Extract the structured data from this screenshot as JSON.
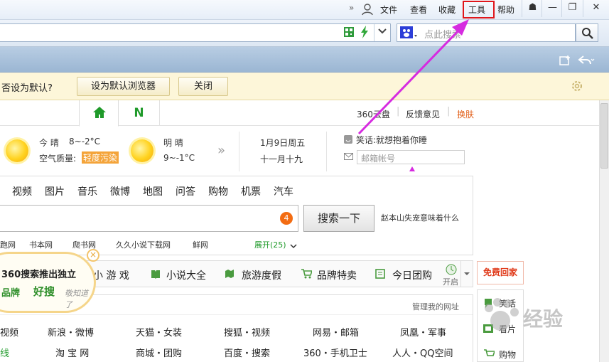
{
  "titlebar": {
    "menus": [
      "文件",
      "查看",
      "收藏",
      "工具",
      "帮助"
    ],
    "more": "»",
    "win_buttons": [
      "☗",
      "—",
      "❐",
      "✕"
    ]
  },
  "addressbar": {
    "search_placeholder": "点此搜索"
  },
  "notify": {
    "text": "否设为默认?",
    "set_default": "设为默认浏览器",
    "close": "关闭"
  },
  "page": {
    "tabs": {
      "home": "⌂",
      "n": "N"
    },
    "toplinks": [
      "360云盘",
      "反馈意见",
      "换肤"
    ],
    "weather": {
      "today_label": "今 晴",
      "today_temp": "8~-2°C",
      "aqi_label": "空气质量:",
      "aqi_value": "轻度污染",
      "tomorrow_label": "明 晴",
      "tomorrow_temp": "9~-1°C",
      "more": "»",
      "date": "1月9日周五",
      "lunar": "十一月十九"
    },
    "joke": "笑话:就想抱着你睡",
    "mail_placeholder": "邮箱帐号",
    "nav": [
      "视频",
      "图片",
      "音乐",
      "微博",
      "地图",
      "问答",
      "购物",
      "机票",
      "汽车"
    ],
    "search": {
      "badge": "4",
      "button": "搜索一下",
      "hot": "赵本山失宠意味着什么"
    },
    "links": [
      "跑网",
      "书本网",
      "爬书网",
      "久久小说下载网",
      "鲜网"
    ],
    "expand": "展开(25)",
    "promo": {
      "line1": "360搜索推出独立",
      "line2": "品牌",
      "brand": "好搜",
      "hand": "敬知道了"
    },
    "categories": [
      "小 游 戏",
      "小说大全",
      "旅游度假",
      "品牌特卖",
      "今日团购"
    ],
    "open_label": "开启",
    "free_home": "免费回家",
    "manage": "管理我的网址",
    "sites_row1": [
      "视频",
      "新浪・微博",
      "天猫・女装",
      "搜狐・视频",
      "网易・邮箱",
      "凤凰・军事"
    ],
    "sites_row2": [
      "线",
      "淘 宝 网",
      "商城・团购",
      "百度・搜索",
      "360・手机卫士",
      "人人・QQ空间"
    ],
    "side": [
      "笑话",
      "看片",
      "购物"
    ],
    "watermark": "经验"
  },
  "colors": {
    "accent_red": "#e0161b",
    "arrow": "#d62be0",
    "green": "#1f9a2a",
    "orange": "#f36c12"
  }
}
